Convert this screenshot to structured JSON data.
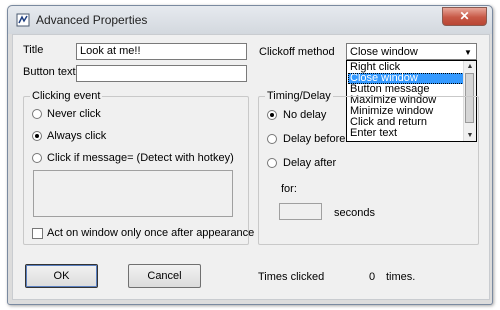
{
  "window": {
    "title": "Advanced Properties",
    "close_glyph": "✕"
  },
  "form": {
    "title_label": "Title",
    "title_value": "Look at me!!",
    "button_text_label": "Button text",
    "button_text_value": "",
    "clickoff_label": "Clickoff method",
    "clickoff_selected": "Close window",
    "clickoff_options": [
      "Right click",
      "Close window",
      "Button message",
      "Maximize window",
      "Minimize window",
      "Click and return",
      "Enter text"
    ],
    "clickoff_highlighted_index": 1
  },
  "clicking_event": {
    "title": "Clicking event",
    "options": [
      "Never click",
      "Always click",
      "Click if message= (Detect with hotkey)"
    ],
    "selected_index": 1,
    "message_value": "",
    "once_label": "Act on window only once after appearance",
    "once_checked": false
  },
  "timing": {
    "title": "Timing/Delay",
    "options": [
      "No delay",
      "Delay before",
      "Delay after"
    ],
    "selected_index": 0,
    "for_label": "for:",
    "seconds_value": "",
    "seconds_label": "seconds"
  },
  "footer": {
    "ok_label": "OK",
    "cancel_label": "Cancel",
    "times_clicked_label": "Times clicked",
    "times_clicked_value": "0",
    "times_suffix": "times."
  },
  "icons": {
    "app": "app-window-icon",
    "close": "close-icon",
    "dropdown": "chevron-down-icon",
    "scroll_up": "scroll-up-arrow-icon",
    "scroll_down": "scroll-down-arrow-icon"
  },
  "colors": {
    "selection": "#3399ff",
    "close_button": "#c75846",
    "dialog_bg": "#f0f0f0"
  }
}
